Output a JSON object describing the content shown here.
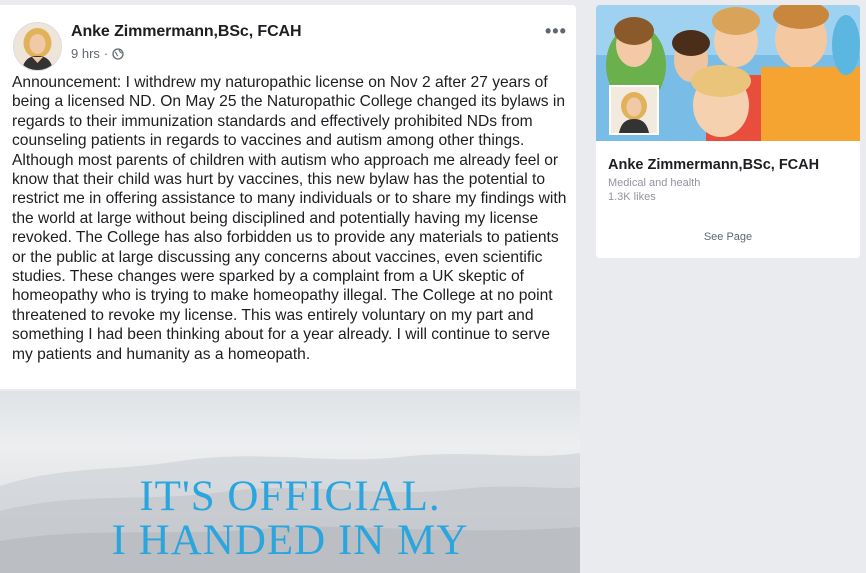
{
  "post": {
    "author": "Anke Zimmermann,BSc, FCAH",
    "time": "9 hrs",
    "separator": "·",
    "privacy_icon": "globe-icon",
    "more_icon": "more-options-icon",
    "more_glyph": "•••",
    "text": "Announcement: I withdrew my naturopathic license on Nov 2 after 27 years of being a licensed ND. On May 25 the Naturopathic College changed its bylaws in regards to their immunization standards and effectively prohibited NDs from counseling patients in regards to vaccines and autism among other things. Although most parents of children with autism who approach me already feel or know that their child was hurt by vaccines, this new bylaw has the potential to restrict me in offering assistance to many individuals or to share my findings with the world at large without being disciplined and potentially having my license revoked. The College has also forbidden us to provide any materials to patients or the public at large discussing any concerns about vaccines, even scientific studies. These changes were sparked by a complaint from a UK skeptic of homeopathy who is trying to make homeopathy illegal. The College at no point threatened to revoke my license. This was entirely voluntary on my part and something I had been thinking about for a year already. I will continue to serve my patients and humanity as a homeopath.",
    "image": {
      "line1": "IT'S OFFICIAL.",
      "line2": "I HANDED IN MY",
      "text_color": "#2aa5dd"
    }
  },
  "page_card": {
    "name": "Anke Zimmermann,BSc, FCAH",
    "category": "Medical and health",
    "likes": "1.3K likes",
    "see_page": "See Page"
  },
  "colors": {
    "background": "#e9ebee",
    "card": "#ffffff",
    "text": "#1c1e21",
    "secondary_text": "#606770",
    "muted_text": "#90949c"
  }
}
